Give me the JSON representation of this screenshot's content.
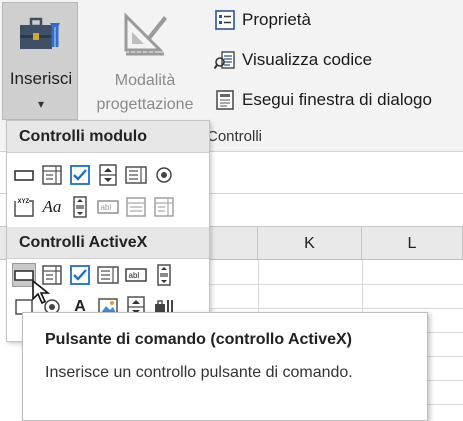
{
  "ribbon": {
    "insert_button": {
      "label": "Inserisci",
      "arrow": "▾",
      "icon": "toolbox-icon"
    },
    "design_mode_button": {
      "label_line1": "Modalità",
      "label_line2": "progettazione",
      "icon": "design-ruler-icon"
    },
    "commands": [
      {
        "label": "Proprietà",
        "icon": "properties-icon"
      },
      {
        "label": "Visualizza codice",
        "icon": "view-code-icon"
      },
      {
        "label": "Esegui finestra di dialogo",
        "icon": "run-dialog-icon"
      }
    ],
    "group_label": "Controlli"
  },
  "sheet": {
    "columns": [
      "K",
      "L"
    ]
  },
  "dropdown": {
    "form_controls_header": "Controlli modulo",
    "activex_header": "Controlli ActiveX",
    "form_row2_text_icon": "Aa",
    "activex_row2_text_icon": "A"
  },
  "tooltip": {
    "title": "Pulsante di comando (controllo ActiveX)",
    "description": "Inserisce un controllo pulsante di comando."
  },
  "colors": {
    "ribbon_bg": "#f3f3f3",
    "selected_bg": "#cfcfcf",
    "checkbox_blue": "#1e6fc9",
    "header_bg": "#e6e6e6"
  }
}
